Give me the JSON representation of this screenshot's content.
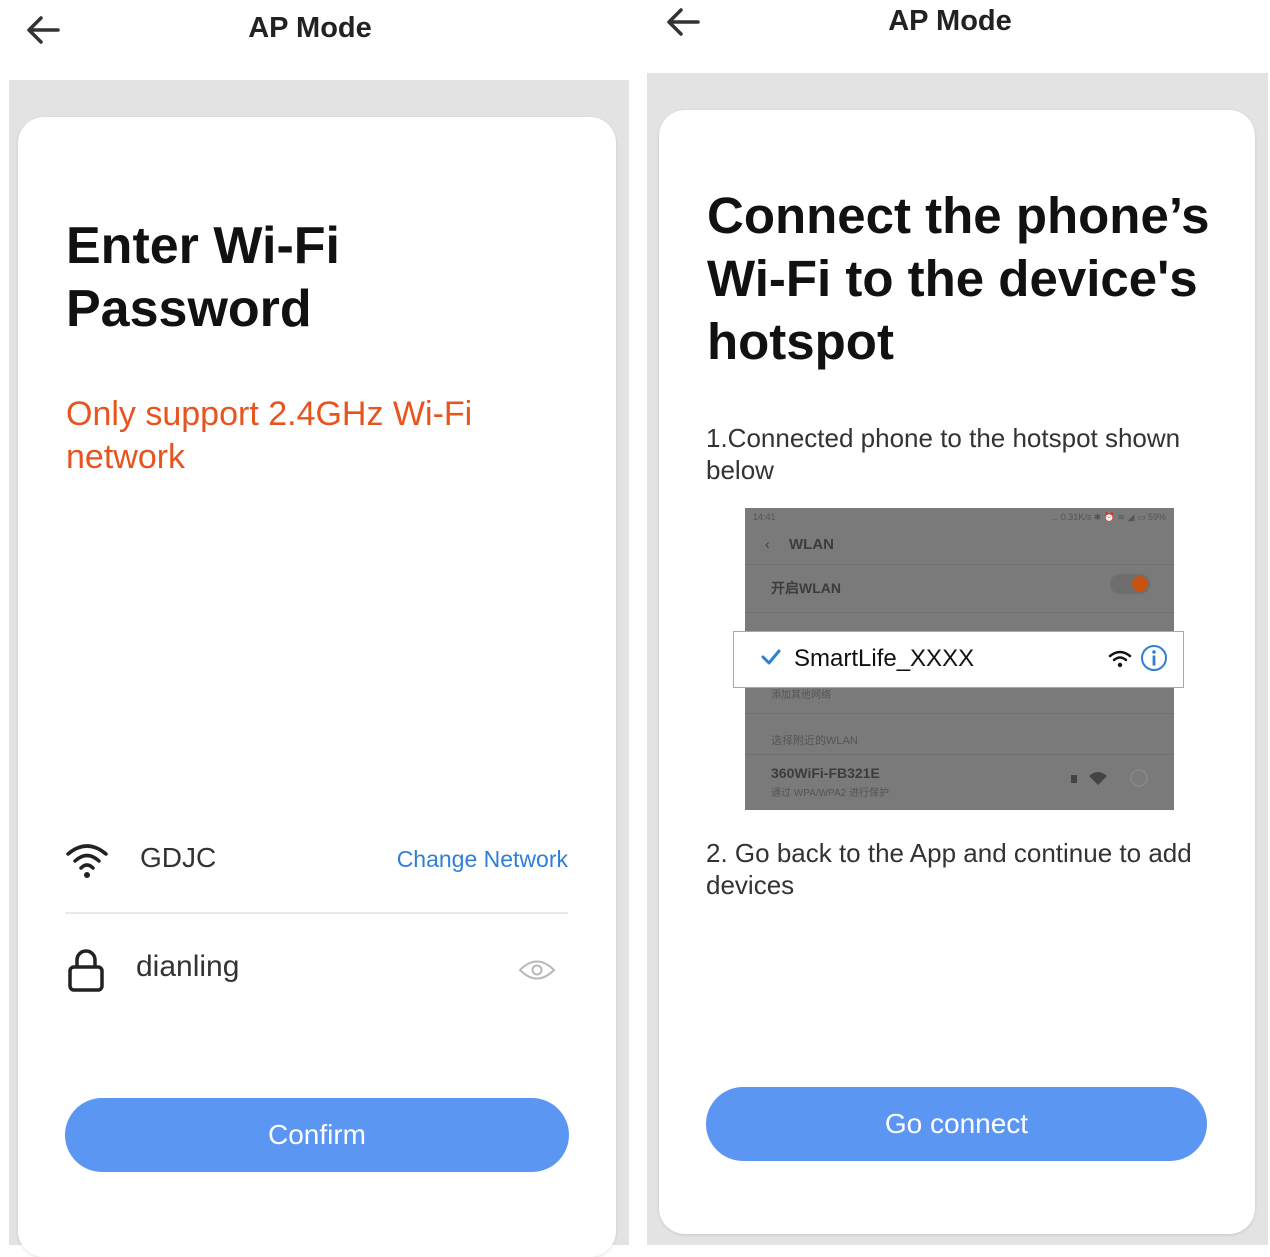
{
  "left_screen": {
    "header": {
      "title": "AP Mode",
      "back_icon": "back-arrow-icon"
    },
    "heading": "Enter Wi-Fi Password",
    "warning": "Only support 2.4GHz Wi-Fi network",
    "network": {
      "ssid": "GDJC",
      "change_label": "Change Network"
    },
    "password": {
      "value": "dianling"
    },
    "confirm_label": "Confirm"
  },
  "right_screen": {
    "header": {
      "title": "AP Mode",
      "back_icon": "back-arrow-icon"
    },
    "heading": "Connect the phone’s Wi-Fi to the device's hotspot",
    "step1": "1.Connected phone to the hotspot shown below",
    "illustration": {
      "status_time": "14:41",
      "status_right": "... 0.31K/s ✱ ⏰ ≋ ◢ ▭ 59%",
      "screen_title": "WLAN",
      "toggle_label": "开启WLAN",
      "hotspot_name": "SmartLife_XXXX",
      "blurred_row": "添加其他网络",
      "section_label": "选择附近的WLAN",
      "other_network": "360WiFi-FB321E",
      "other_network_sub": "通过 WPA/WPA2 进行保护"
    },
    "step2": "2. Go back to the App and continue to add devices",
    "connect_label": "Go connect"
  },
  "colors": {
    "accent_button": "#5b96f2",
    "warning": "#e8541e",
    "link": "#2f7fd6",
    "check_blue": "#2f7fd6",
    "toggle_on": "#c8520f"
  }
}
